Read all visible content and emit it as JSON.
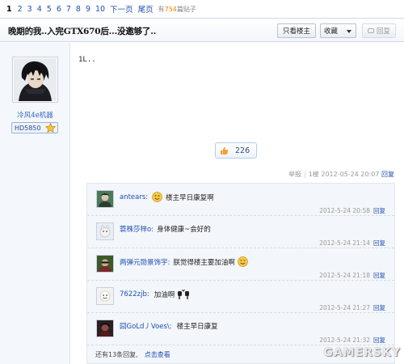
{
  "pager": {
    "current": "1",
    "pages": [
      "2",
      "3",
      "4",
      "5",
      "6",
      "7",
      "8",
      "9",
      "10"
    ],
    "next": "下一页",
    "last": "尾页",
    "total_prefix": "有",
    "total_count": "754",
    "total_suffix": "篇贴子"
  },
  "thread": {
    "title": "晚期的我..入完GTX670后...没邀够了..",
    "buttons": {
      "only_op": "只看楼主",
      "favorite": "收藏",
      "reply": "回复"
    }
  },
  "author": {
    "name": "冷风4e机器",
    "badge": "HD5850"
  },
  "post": {
    "content": "1L..",
    "likes": "226",
    "report": "举报",
    "floor": "1楼",
    "time": "2012-05-24 20:07",
    "reply": "回复"
  },
  "replies": [
    {
      "name": "antears:",
      "text": "楼主早日康复啊",
      "time": "2012-5-24 20:58",
      "reply": "回复",
      "emoji": "smile"
    },
    {
      "name": "蓑株莎梓o:",
      "text": "身体健康~会好的",
      "time": "2012-5-24 21:14",
      "reply": "回复",
      "emoji": ""
    },
    {
      "name": "两弹元勋景饰宇:",
      "text": "朕觉得楼主要加油啊",
      "time": "2012-5-24 21:18",
      "reply": "回复",
      "emoji": "smile"
    },
    {
      "name": "7622zjb:",
      "text": "加油啊",
      "time": "2012-5-24 21:27",
      "reply": "回复",
      "emoji": "fists"
    },
    {
      "name": "囧GoLd丿Voes\\:",
      "text": "楼主早日康复",
      "time": "2012-5-24 21:32",
      "reply": "回复",
      "emoji": ""
    }
  ],
  "more": {
    "text": "还有13条回复,",
    "link": "点击查看"
  },
  "watermark": "GAMERSKY"
}
